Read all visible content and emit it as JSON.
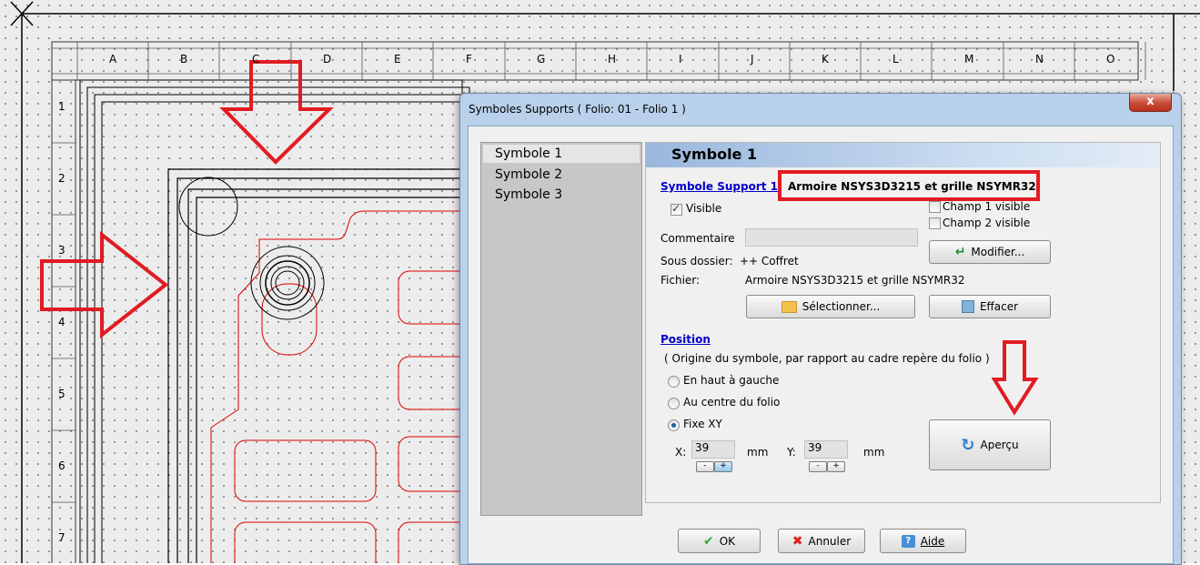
{
  "grid": {
    "columns": [
      "A",
      "B",
      "C",
      "D",
      "E",
      "F",
      "G",
      "H",
      "I",
      "J",
      "K",
      "L",
      "M",
      "N",
      "O"
    ],
    "rows": [
      "1",
      "2",
      "3",
      "4",
      "5",
      "6",
      "7"
    ]
  },
  "dialog": {
    "title": "Symboles Supports ( Folio: 01 - Folio 1 )",
    "close_label": "x",
    "list": [
      "Symbole 1",
      "Symbole 2",
      "Symbole 3"
    ],
    "panel_title": "Symbole 1",
    "symbol_support_label": "Symbole Support 1",
    "symbol_support_name": "Armoire NSYS3D3215 et grille NSYMR32",
    "visible_label": "Visible",
    "visible_checked": true,
    "champ1_label": "Champ 1 visible",
    "champ2_label": "Champ 2 visible",
    "commentaire_label": "Commentaire",
    "commentaire_value": "",
    "sous_dossier_label": "Sous dossier:",
    "sous_dossier_value": "++ Coffret",
    "fichier_label": "Fichier:",
    "fichier_value": "Armoire NSYS3D3215 et grille NSYMR32",
    "modifier_label": "Modifier...",
    "selectionner_label": "Sélectionner...",
    "effacer_label": "Effacer",
    "position_label": "Position",
    "position_note": "( Origine du symbole, par rapport au cadre repère du folio )",
    "radio_options": [
      "En haut à gauche",
      "Au centre du folio",
      "Fixe XY"
    ],
    "radio_selected": "Fixe XY",
    "x_label": "X:",
    "x_value": "39",
    "y_label": "Y:",
    "y_value": "39",
    "unit": "mm",
    "spin_minus": "-",
    "spin_plus": "+",
    "apercu_label": "Aperçu",
    "ok_label": "OK",
    "annuler_label": "Annuler",
    "aide_label": "Aide"
  },
  "colors": {
    "annotation_red": "#e21b22",
    "drawing_red": "#e00000",
    "link_blue": "#0000c8"
  }
}
